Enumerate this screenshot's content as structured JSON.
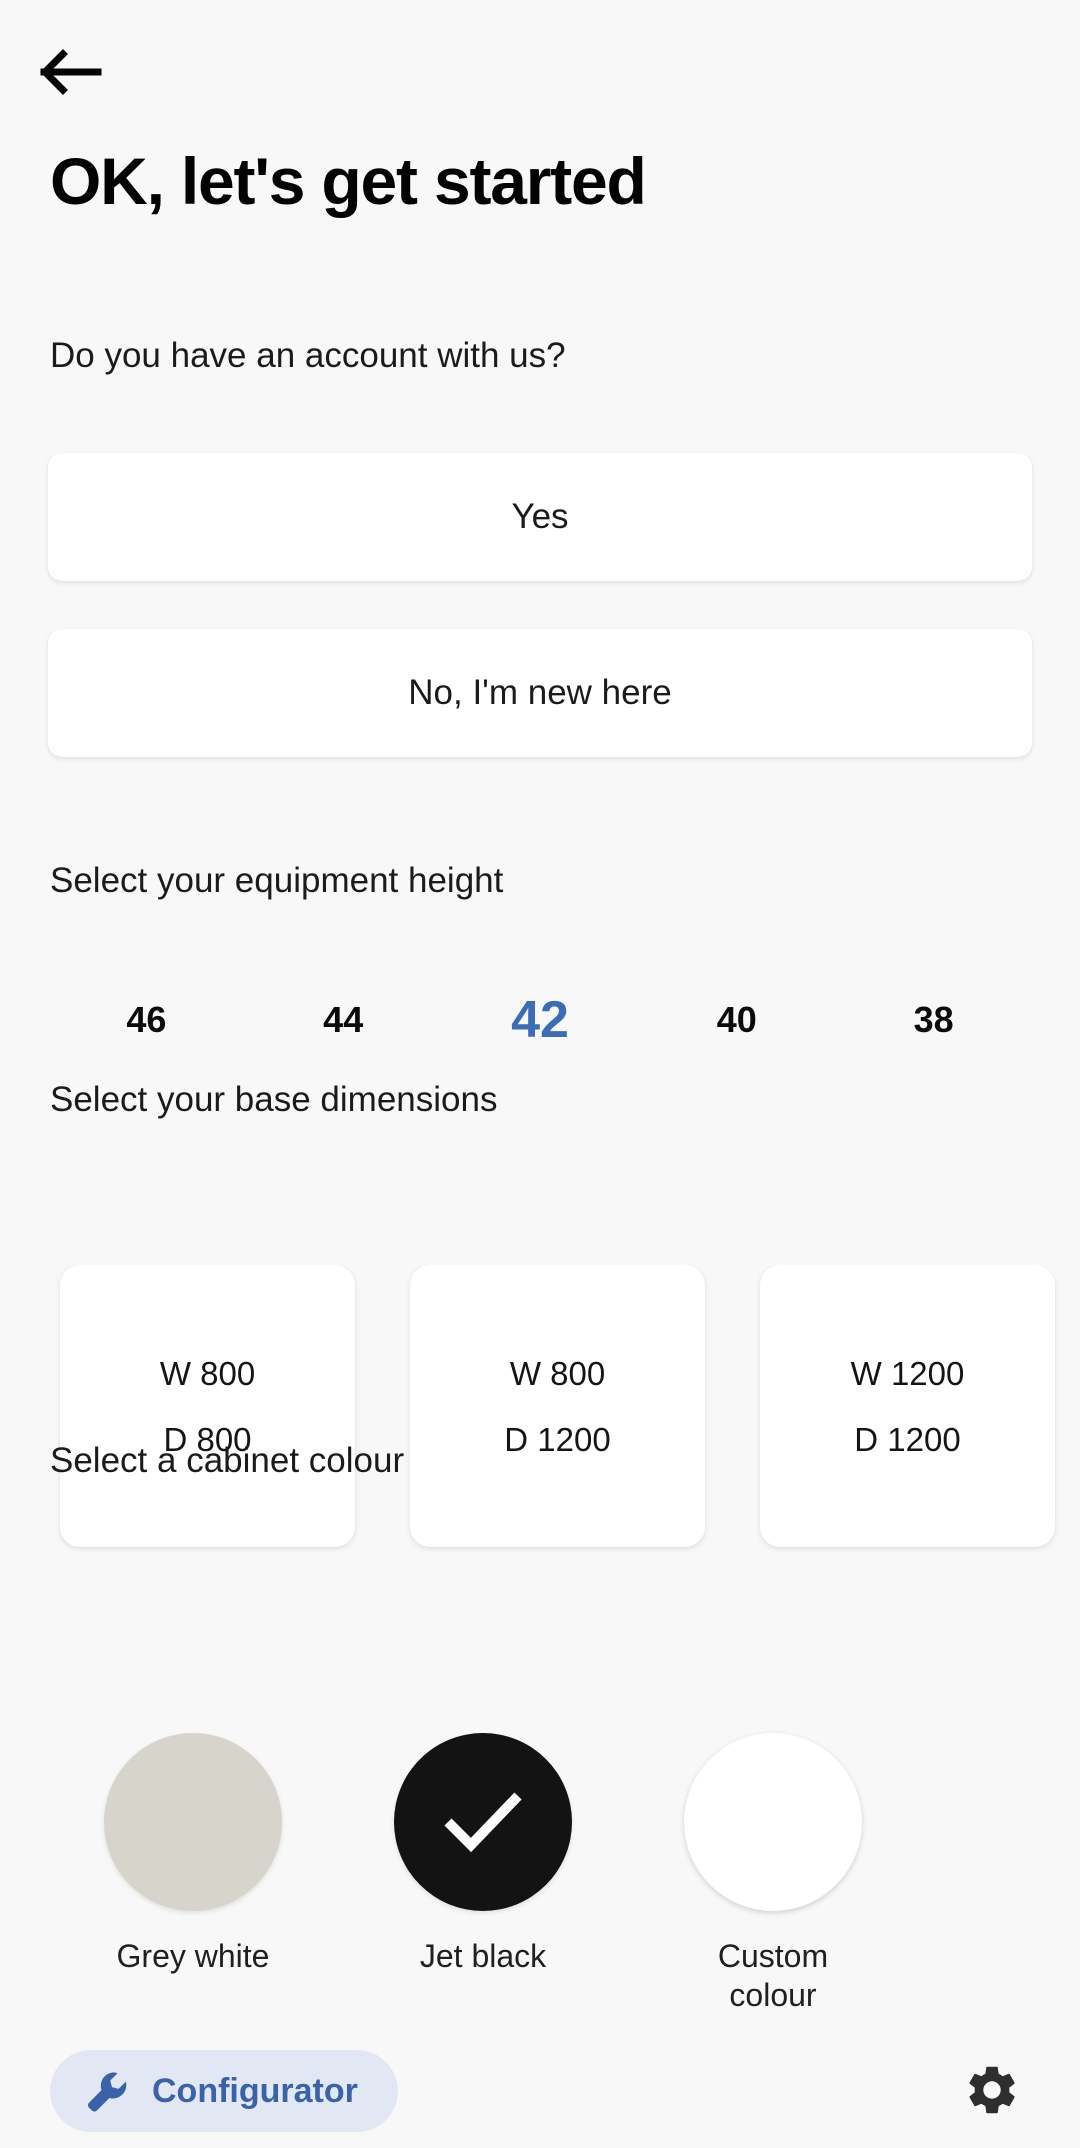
{
  "header": {
    "back_icon": "arrow-left-icon",
    "title": "OK, let's get started",
    "subtitle": "Do you have an account with us?"
  },
  "account": {
    "options": [
      {
        "label": "Yes"
      },
      {
        "label": "No, I'm new here"
      }
    ]
  },
  "equipment_height": {
    "label": "Select your equipment height",
    "options": [
      {
        "value": "46",
        "selected": false
      },
      {
        "value": "44",
        "selected": false
      },
      {
        "value": "42",
        "selected": true
      },
      {
        "value": "40",
        "selected": false
      },
      {
        "value": "38",
        "selected": false
      }
    ],
    "selected_value": "42",
    "selected_color": "#3C6CB4"
  },
  "base_dimensions": {
    "label": "Select your base dimensions",
    "cards": [
      {
        "width": "W 800",
        "depth": "D 800"
      },
      {
        "width": "W 800",
        "depth": "D 1200"
      },
      {
        "width": "W 1200",
        "depth": "D 1200"
      }
    ]
  },
  "cabinet_colour": {
    "label": "Select a cabinet colour",
    "options": [
      {
        "name": "Grey white",
        "hex": "#D7D4CB",
        "selected": false,
        "icon": ""
      },
      {
        "name": "Jet black",
        "hex": "#131313",
        "selected": true,
        "icon": "check-icon"
      },
      {
        "name": "Custom colour",
        "hex": "#FFFFFF",
        "selected": false,
        "icon": ""
      }
    ]
  },
  "bottom_nav": {
    "configurator_label": "Configurator",
    "configurator_icon": "wrench-icon",
    "configurator_accent": "#3A62A8",
    "configurator_pill_bg": "#E2E7F4",
    "settings_icon": "gear-icon"
  }
}
